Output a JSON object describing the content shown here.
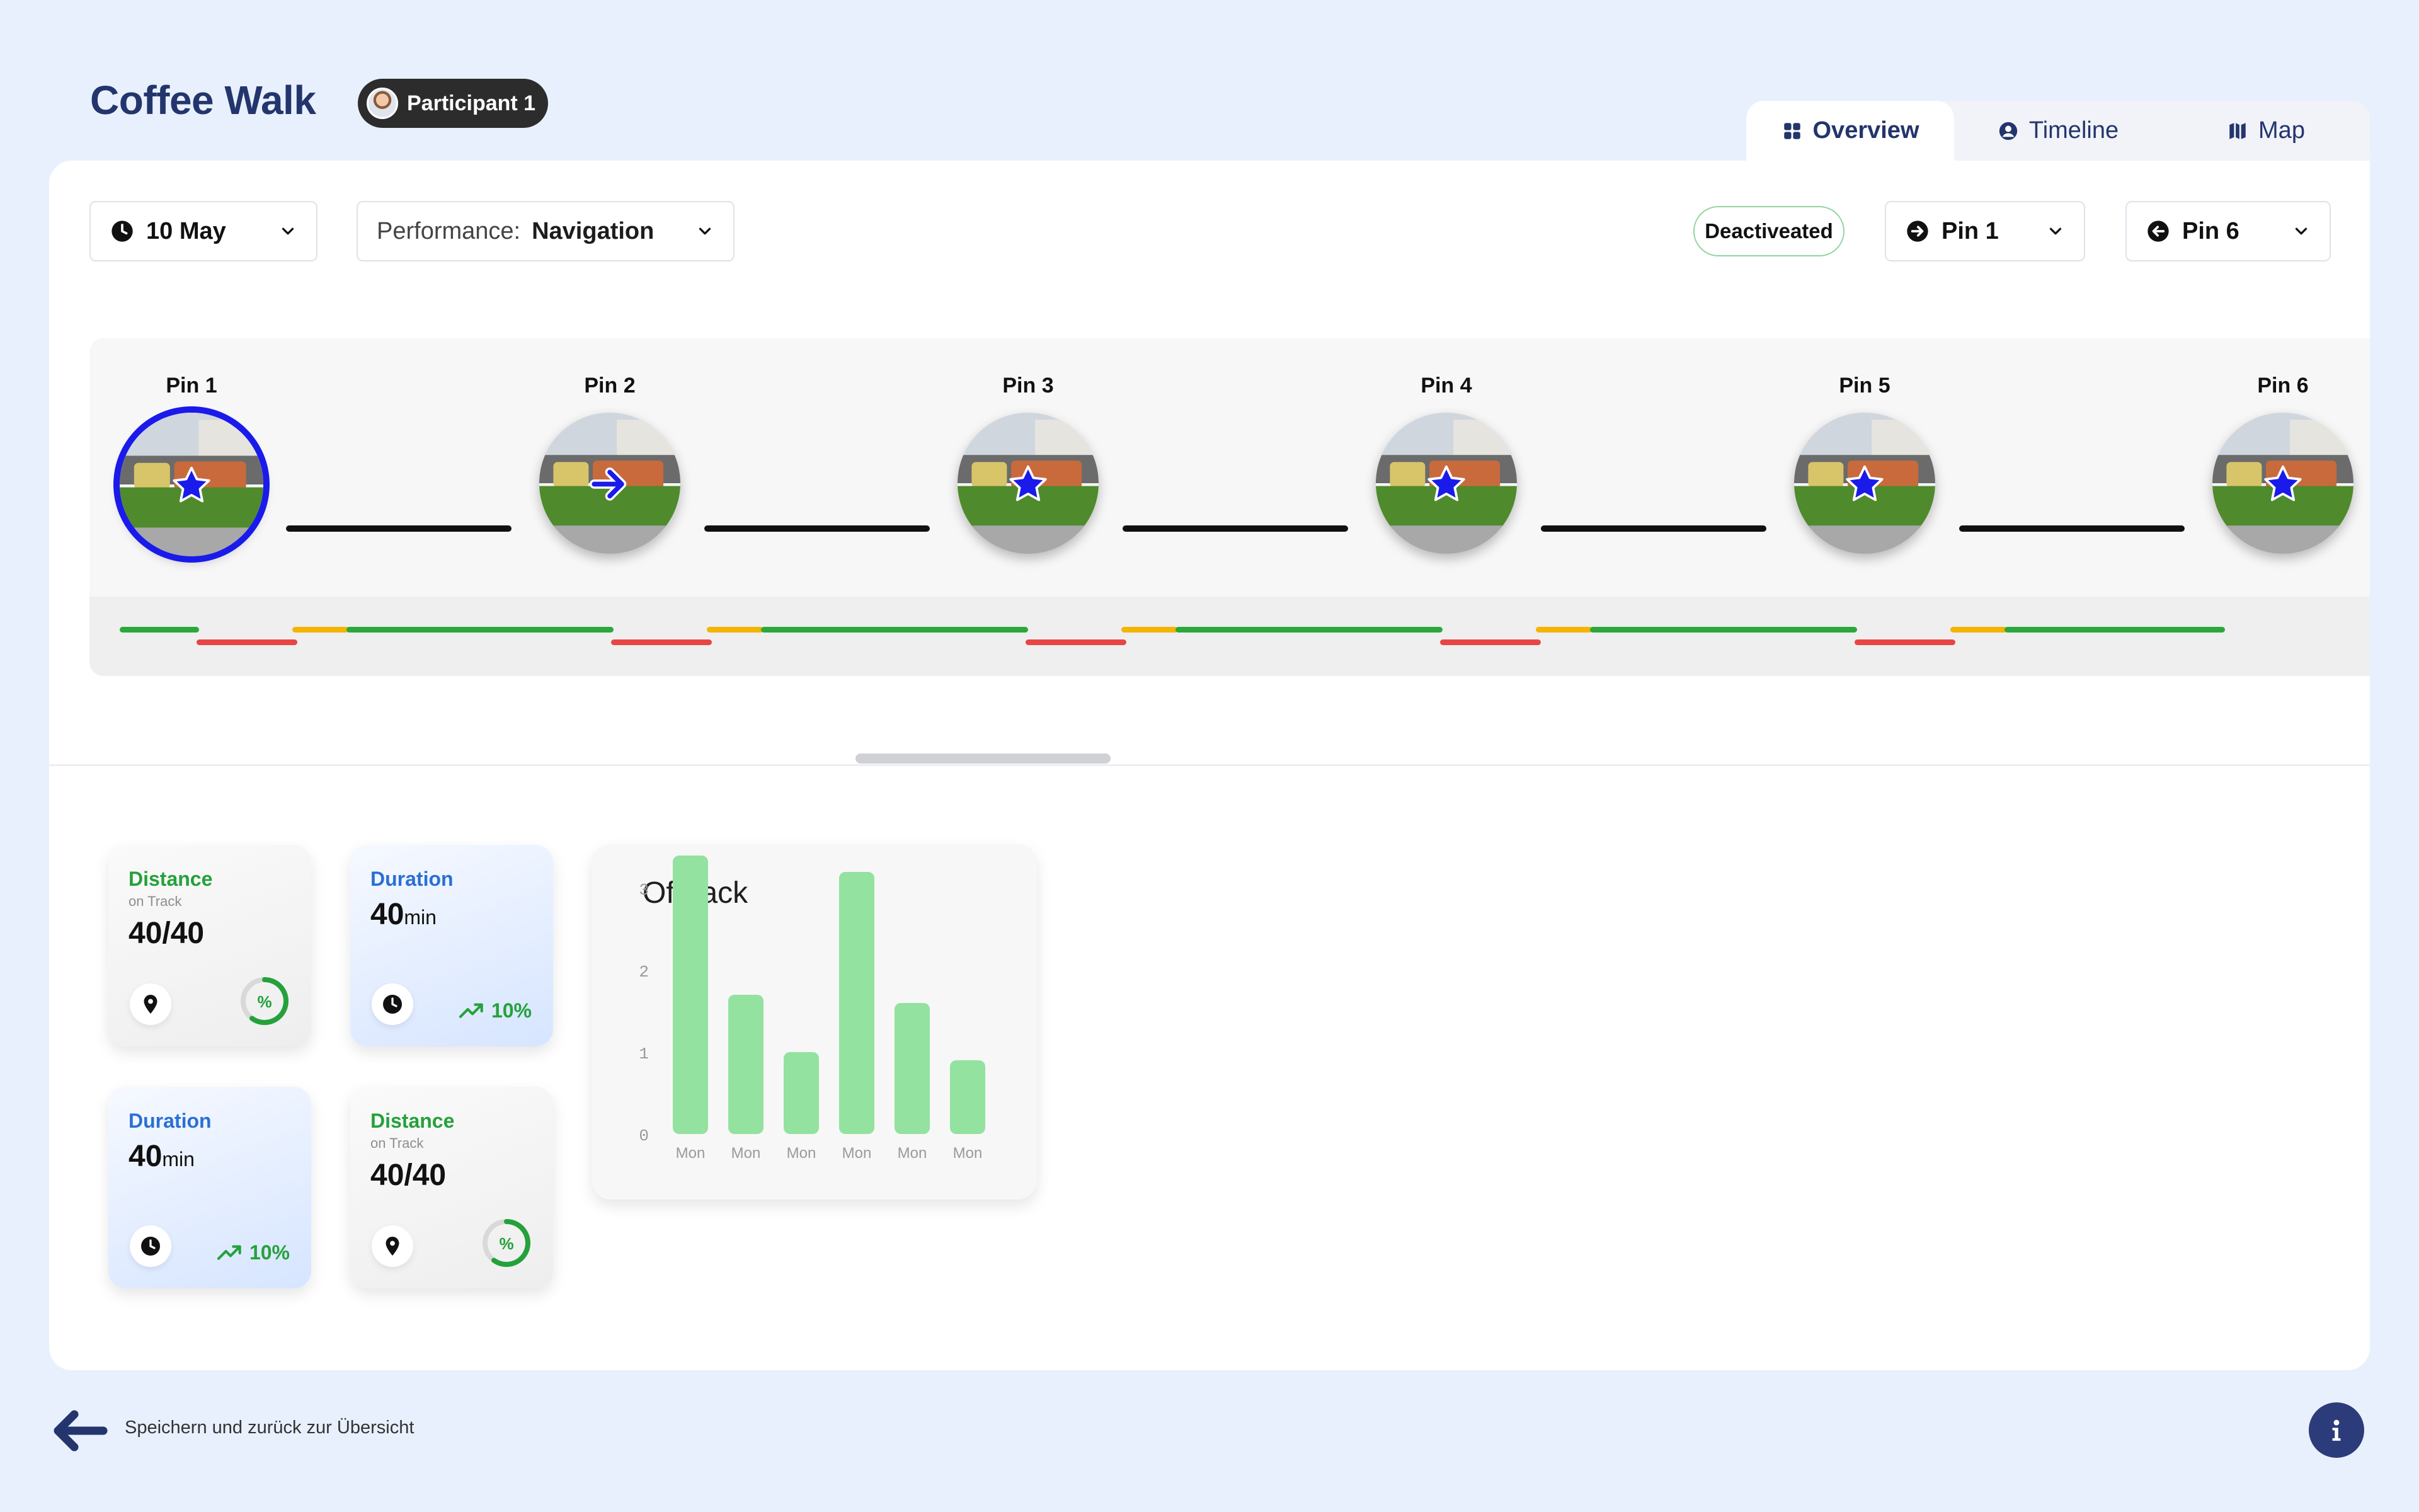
{
  "header": {
    "title": "Coffee Walk",
    "participant": "Participant 1"
  },
  "view_tabs": [
    {
      "label": "Overview",
      "icon": "grid-icon",
      "active": true
    },
    {
      "label": "Timeline",
      "icon": "user-circle-icon",
      "active": false
    },
    {
      "label": "Map",
      "icon": "map-icon",
      "active": false
    }
  ],
  "filters": {
    "date": "10 May",
    "performance_prefix": "Performance:",
    "performance_value": "Navigation",
    "status": "Deactiveated",
    "from_pin": "Pin 1",
    "to_pin": "Pin 6"
  },
  "pins": [
    {
      "label": "Pin 1",
      "marker": "star-icon",
      "selected": true
    },
    {
      "label": "Pin 2",
      "marker": "arrow-right-icon",
      "selected": false
    },
    {
      "label": "Pin 3",
      "marker": "star-icon",
      "selected": false
    },
    {
      "label": "Pin 4",
      "marker": "star-icon",
      "selected": false
    },
    {
      "label": "Pin 5",
      "marker": "star-icon",
      "selected": false
    },
    {
      "label": "Pin 6",
      "marker": "star-icon",
      "selected": false
    }
  ],
  "colors": {
    "accent": "#23356c",
    "selected_ring": "#1a1aeb",
    "on_track": "#2aa83a",
    "off_track": "#e84545",
    "warning": "#f4b400",
    "bar": "#93e29f"
  },
  "stats": [
    {
      "title": "Distance",
      "subtitle": "on Track",
      "value": "40/40",
      "unit": "",
      "icon": "location-pin-icon",
      "indicator": "%",
      "style": "grey"
    },
    {
      "title": "Duration",
      "subtitle": "",
      "value": "40",
      "unit": "min",
      "icon": "clock-icon",
      "indicator": "10%",
      "style": "blue"
    },
    {
      "title": "Duration",
      "subtitle": "",
      "value": "40",
      "unit": "min",
      "icon": "clock-icon",
      "indicator": "10%",
      "style": "blue"
    },
    {
      "title": "Distance",
      "subtitle": "on Track",
      "value": "40/40",
      "unit": "",
      "icon": "location-pin-icon",
      "indicator": "%",
      "style": "grey"
    }
  ],
  "chart_data": {
    "type": "bar",
    "title": "Offtrack",
    "categories": [
      "Mon",
      "Mon",
      "Mon",
      "Mon",
      "Mon",
      "Mon"
    ],
    "values": [
      3.4,
      1.7,
      1.0,
      3.2,
      1.6,
      0.9
    ],
    "yticks": [
      "3",
      "2",
      "1",
      "0"
    ],
    "ylim": [
      0,
      3.4
    ],
    "xlabel": "",
    "ylabel": "",
    "grid": false,
    "legend": "none"
  },
  "footer": {
    "back_label": "Speichern und zurück zur Übersicht"
  }
}
